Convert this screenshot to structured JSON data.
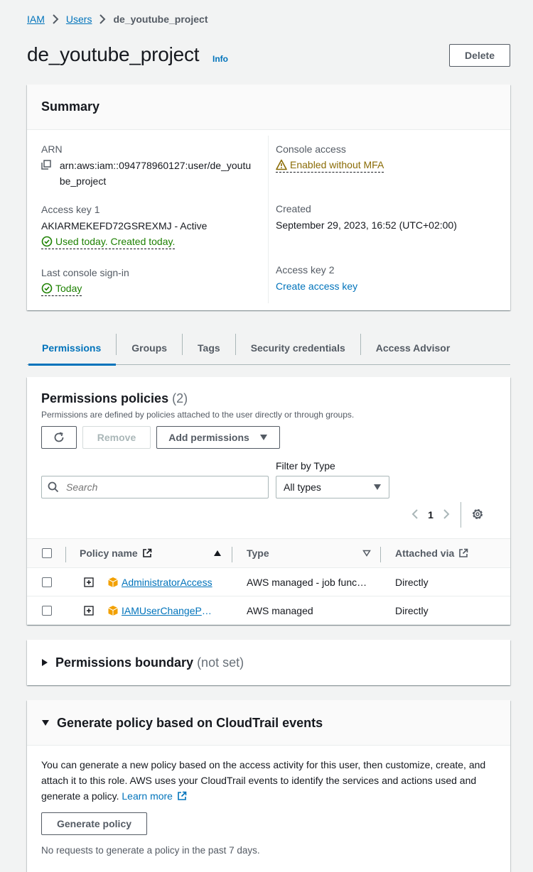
{
  "breadcrumb": {
    "iam": "IAM",
    "users": "Users",
    "current": "de_youtube_project"
  },
  "page": {
    "title": "de_youtube_project",
    "info": "Info",
    "delete_label": "Delete"
  },
  "summary": {
    "title": "Summary",
    "arn_label": "ARN",
    "arn_value": "arn:aws:iam::094778960127:user/de_youtube_project",
    "access_key1_label": "Access key 1",
    "access_key1_value": "AKIARMEKEFD72GSREXMJ - Active",
    "access_key1_status": "Used today. Created today.",
    "last_signin_label": "Last console sign-in",
    "last_signin_value": "Today",
    "console_access_label": "Console access",
    "console_access_value": "Enabled without MFA",
    "created_label": "Created",
    "created_value": "September 29, 2023, 16:52 (UTC+02:00)",
    "access_key2_label": "Access key 2",
    "access_key2_link": "Create access key"
  },
  "tabs": [
    "Permissions",
    "Groups",
    "Tags",
    "Security credentials",
    "Access Advisor"
  ],
  "policies": {
    "title": "Permissions policies",
    "count": "(2)",
    "description": "Permissions are defined by policies attached to the user directly or through groups.",
    "remove_label": "Remove",
    "add_label": "Add permissions",
    "filter_label": "Filter by Type",
    "search_placeholder": "Search",
    "type_selected": "All types",
    "page": "1",
    "columns": {
      "name": "Policy name",
      "type": "Type",
      "attached": "Attached via"
    },
    "rows": [
      {
        "name": "AdministratorAccess",
        "type": "AWS managed - job function",
        "attached": "Directly"
      },
      {
        "name": "IAMUserChangePassword",
        "type": "AWS managed",
        "attached": "Directly"
      }
    ]
  },
  "boundary": {
    "title": "Permissions boundary",
    "status": "(not set)"
  },
  "generate": {
    "title": "Generate policy based on CloudTrail events",
    "body": "You can generate a new policy based on the access activity for this user, then customize, create, and attach it to this role. AWS uses your CloudTrail events to identify the services and actions used and generate a policy.",
    "learn_more": "Learn more",
    "button": "Generate policy",
    "note": "No requests to generate a policy in the past 7 days."
  },
  "colors": {
    "link": "#0073bb",
    "success": "#1d8102",
    "warning": "#8a6b05",
    "policy_icon": "#f2a000"
  }
}
